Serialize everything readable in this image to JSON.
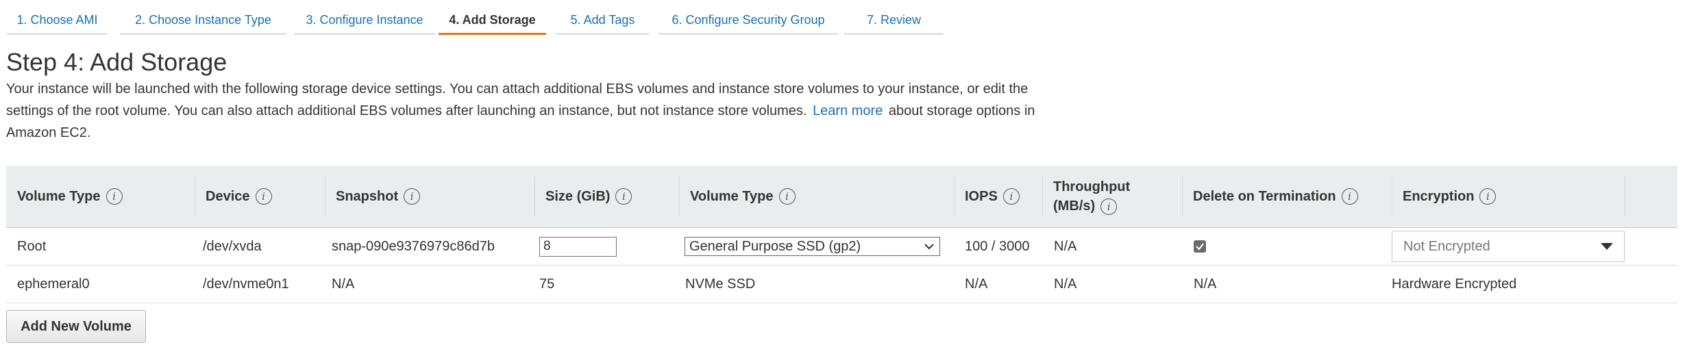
{
  "tabs": [
    {
      "label": "1. Choose AMI",
      "active": false
    },
    {
      "label": "2. Choose Instance Type",
      "active": false
    },
    {
      "label": "3. Configure Instance",
      "active": false
    },
    {
      "label": "4. Add Storage",
      "active": true
    },
    {
      "label": "5. Add Tags",
      "active": false
    },
    {
      "label": "6. Configure Security Group",
      "active": false
    },
    {
      "label": "7. Review",
      "active": false
    }
  ],
  "page": {
    "title": "Step 4: Add Storage",
    "description_part1": "Your instance will be launched with the following storage device settings. You can attach additional EBS volumes and instance store volumes to your instance, or edit the settings of the root volume. You can also attach additional EBS volumes after launching an instance, but not instance store volumes.",
    "learn_more": "Learn more",
    "description_part2": "about storage options in Amazon EC2."
  },
  "table": {
    "headers": {
      "volume_type": "Volume Type",
      "device": "Device",
      "snapshot": "Snapshot",
      "size": "Size (GiB)",
      "ebs_volume_type": "Volume Type",
      "iops": "IOPS",
      "throughput_line1": "Throughput",
      "throughput_line2": "(MB/s)",
      "delete_on_termination": "Delete on Termination",
      "encryption": "Encryption"
    },
    "info_glyph": "i",
    "rows": [
      {
        "volume_type": "Root",
        "device": "/dev/xvda",
        "snapshot": "snap-090e9376979c86d7b",
        "size": "8",
        "ebs_volume_type": "General Purpose SSD (gp2)",
        "iops": "100 / 3000",
        "throughput": "N/A",
        "delete_on_termination": true,
        "encryption": "Not Encrypted"
      },
      {
        "volume_type": "ephemeral0",
        "device": "/dev/nvme0n1",
        "snapshot": "N/A",
        "size": "75",
        "ebs_volume_type": "NVMe SSD",
        "iops": "N/A",
        "throughput": "N/A",
        "delete_on_termination": "N/A",
        "encryption": "Hardware Encrypted"
      }
    ]
  },
  "buttons": {
    "add_new_volume": "Add New Volume"
  },
  "colors": {
    "link": "#1a6fb5",
    "active_tab_underline": "#ec7211",
    "header_bg": "#eaeded"
  },
  "icons": {
    "info": "info-icon",
    "checkbox": "checkbox-checked-icon",
    "dropdown": "chevron-down-icon",
    "caret": "caret-down-icon"
  }
}
